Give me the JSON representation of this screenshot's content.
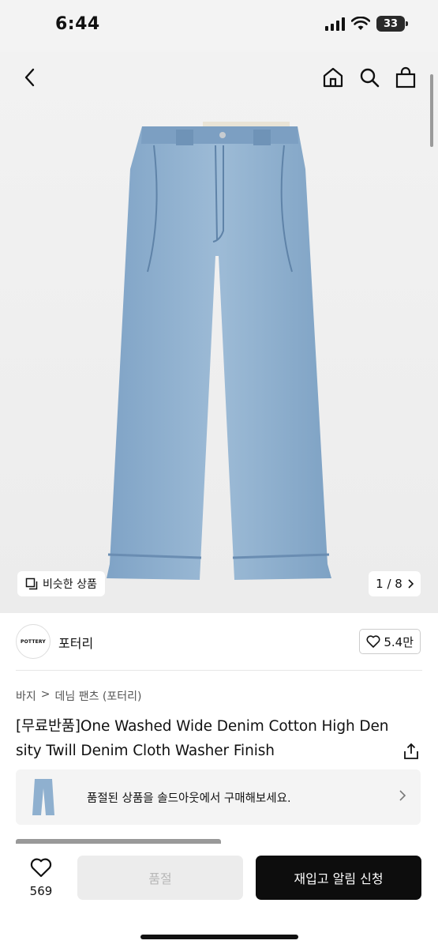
{
  "status": {
    "time": "6:44",
    "battery": "33"
  },
  "nav": {
    "back_icon": "chevron-left-icon",
    "home_icon": "home-icon",
    "search_icon": "search-icon",
    "bag_icon": "shopping-bag-icon"
  },
  "gallery": {
    "similar_label": "비슷한 상품",
    "page_indicator": "1 / 8"
  },
  "brand": {
    "logo_text": "POTTERY",
    "name": "포터리",
    "like_count": "5.4만"
  },
  "breadcrumb": [
    "바지",
    "데님 팬츠 (포터리)"
  ],
  "product": {
    "title": "[무료반품]One Washed Wide Denim Cotton High Density Twill Denim Cloth Washer Finish"
  },
  "soldout_banner": {
    "text": "품절된 상품을 솔드아웃에서 구매해보세요."
  },
  "bottom": {
    "wish_count": "569",
    "soldout_label": "품절",
    "restock_label": "재입고 알림 신청"
  },
  "colors": {
    "primary": "#0d0d0d",
    "denim": "#8fb0cf",
    "disabled": "#ececec"
  }
}
